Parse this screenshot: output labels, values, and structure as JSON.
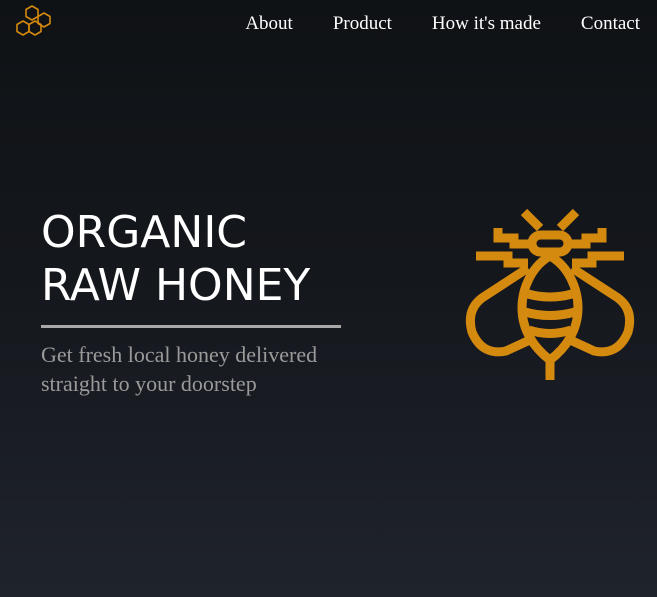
{
  "header": {
    "logo_icon": "honeycomb-icon",
    "nav": [
      {
        "label": "About"
      },
      {
        "label": "Product"
      },
      {
        "label": "How it's made"
      },
      {
        "label": "Contact"
      }
    ]
  },
  "hero": {
    "title_line1": "ORGANIC",
    "title_line2": "RAW HONEY",
    "tagline_line1": "Get fresh local honey delivered",
    "tagline_line2": "straight to your doorstep",
    "illustration_icon": "bee-icon"
  },
  "colors": {
    "accent": "#d4890f",
    "background_top": "#0f1215",
    "background_bottom": "#1f232b",
    "text_primary": "#ffffff",
    "text_muted": "#9a9a9a",
    "divider": "#a8a8a8"
  }
}
